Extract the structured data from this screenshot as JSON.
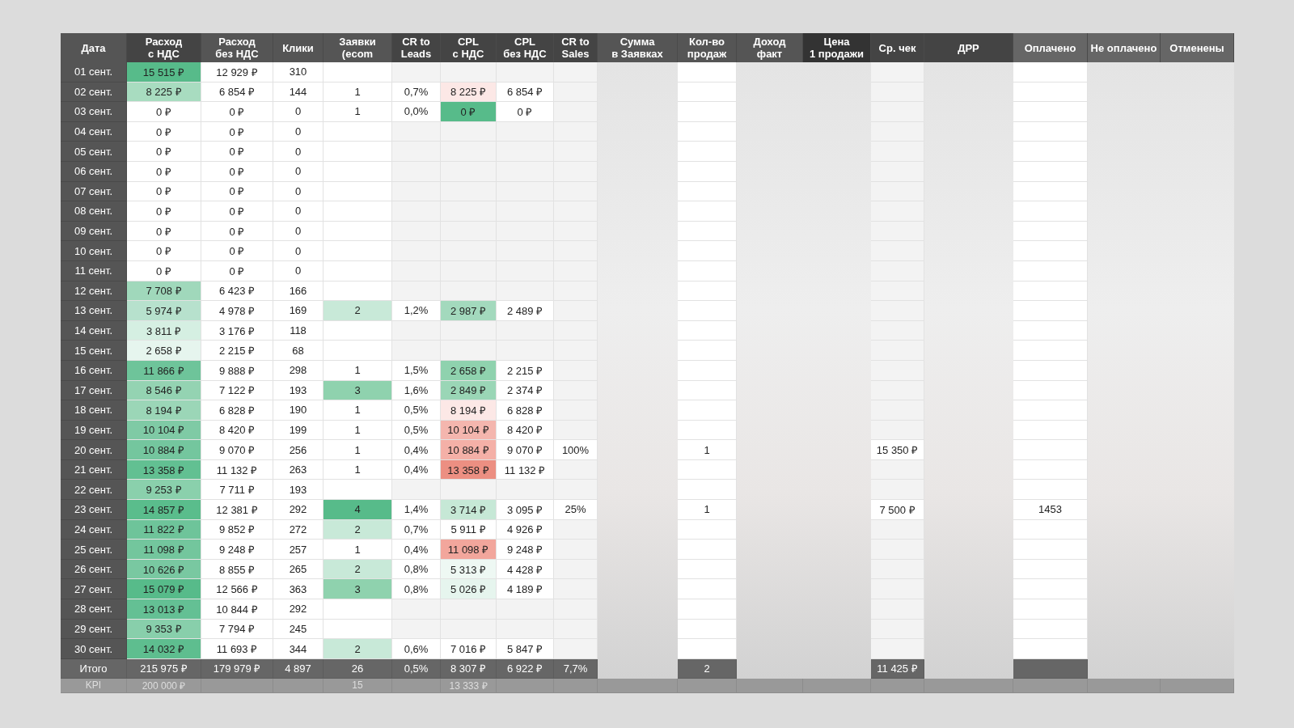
{
  "columns": [
    {
      "label": "Дата",
      "masked": false
    },
    {
      "label": "Расход\nс НДС",
      "masked": false
    },
    {
      "label": "Расход\nбез НДС",
      "masked": false
    },
    {
      "label": "Клики",
      "masked": false
    },
    {
      "label": "Заявки\n(ecom",
      "masked": false
    },
    {
      "label": "CR to\nLeads",
      "masked": false
    },
    {
      "label": "CPL\nс НДС",
      "masked": false
    },
    {
      "label": "CPL\nбез НДС",
      "masked": false
    },
    {
      "label": "CR to\nSales",
      "masked": false
    },
    {
      "label": "Сумма\nв Заявках",
      "masked": true
    },
    {
      "label": "Кол-во\nпродаж",
      "masked": false
    },
    {
      "label": "Доход\nфакт",
      "masked": true
    },
    {
      "label": "Цена\n1 продажи",
      "masked": true
    },
    {
      "label": "Ср. чек",
      "masked": false
    },
    {
      "label": "ДРР",
      "masked": true
    },
    {
      "label": "Оплачено",
      "masked": false
    },
    {
      "label": "Не оплачено",
      "masked": true
    },
    {
      "label": "Отменены",
      "masked": true
    }
  ],
  "rows": [
    {
      "date": "01 сент.",
      "spend_vat": {
        "text": "15 515 ₽",
        "color": "#57bb8a"
      },
      "spend_net": "12 929 ₽",
      "clicks": "310"
    },
    {
      "date": "02 сент.",
      "spend_vat": {
        "text": "8 225 ₽",
        "color": "#a8dcc0"
      },
      "spend_net": "6 854 ₽",
      "clicks": "144",
      "leads": "1",
      "cr_leads": "0,7%",
      "cpl_vat": {
        "text": "8 225 ₽",
        "color": "#fce8e6"
      },
      "cpl_net": "6 854 ₽"
    },
    {
      "date": "03 сент.",
      "spend_vat": "0 ₽",
      "spend_net": "0 ₽",
      "clicks": "0",
      "leads": "1",
      "cr_leads": "0,0%",
      "cpl_vat": {
        "text": "0 ₽",
        "color": "#57bb8a"
      },
      "cpl_net": "0 ₽"
    },
    {
      "date": "04 сент.",
      "spend_vat": "0 ₽",
      "spend_net": "0 ₽",
      "clicks": "0"
    },
    {
      "date": "05 сент.",
      "spend_vat": "0 ₽",
      "spend_net": "0 ₽",
      "clicks": "0"
    },
    {
      "date": "06 сент.",
      "spend_vat": "0 ₽",
      "spend_net": "0 ₽",
      "clicks": "0"
    },
    {
      "date": "07 сент.",
      "spend_vat": "0 ₽",
      "spend_net": "0 ₽",
      "clicks": "0"
    },
    {
      "date": "08 сент.",
      "spend_vat": "0 ₽",
      "spend_net": "0 ₽",
      "clicks": "0"
    },
    {
      "date": "09 сент.",
      "spend_vat": "0 ₽",
      "spend_net": "0 ₽",
      "clicks": "0"
    },
    {
      "date": "10 сент.",
      "spend_vat": "0 ₽",
      "spend_net": "0 ₽",
      "clicks": "0"
    },
    {
      "date": "11 сент.",
      "spend_vat": "0 ₽",
      "spend_net": "0 ₽",
      "clicks": "0"
    },
    {
      "date": "12 сент.",
      "spend_vat": {
        "text": "7 708 ₽",
        "color": "#a0d8bb"
      },
      "spend_net": "6 423 ₽",
      "clicks": "166"
    },
    {
      "date": "13 сент.",
      "spend_vat": {
        "text": "5 974 ₽",
        "color": "#b7e1cd"
      },
      "spend_net": "4 978 ₽",
      "clicks": "169",
      "leads": {
        "text": "2",
        "color": "#c8e9d8"
      },
      "cr_leads": "1,2%",
      "cpl_vat": {
        "text": "2 987 ₽",
        "color": "#a3d9bd"
      },
      "cpl_net": "2 489 ₽"
    },
    {
      "date": "14 сент.",
      "spend_vat": {
        "text": "3 811 ₽",
        "color": "#d5efe2"
      },
      "spend_net": "3 176 ₽",
      "clicks": "118"
    },
    {
      "date": "15 сент.",
      "spend_vat": {
        "text": "2 658 ₽",
        "color": "#e6f5ee"
      },
      "spend_net": "2 215 ₽",
      "clicks": "68"
    },
    {
      "date": "16 сент.",
      "spend_vat": {
        "text": "11 866 ₽",
        "color": "#6ec49a"
      },
      "spend_net": "9 888 ₽",
      "clicks": "298",
      "leads": "1",
      "cr_leads": "1,5%",
      "cpl_vat": {
        "text": "2 658 ₽",
        "color": "#8fd2ae"
      },
      "cpl_net": "2 215 ₽"
    },
    {
      "date": "17 сент.",
      "spend_vat": {
        "text": "8 546 ₽",
        "color": "#94d3b2"
      },
      "spend_net": "7 122 ₽",
      "clicks": "193",
      "leads": {
        "text": "3",
        "color": "#8fd2ae"
      },
      "cr_leads": "1,6%",
      "cpl_vat": {
        "text": "2 849 ₽",
        "color": "#9ad6b6"
      },
      "cpl_net": "2 374 ₽"
    },
    {
      "date": "18 сент.",
      "spend_vat": {
        "text": "8 194 ₽",
        "color": "#9bd6b7"
      },
      "spend_net": "6 828 ₽",
      "clicks": "190",
      "leads": "1",
      "cr_leads": "0,5%",
      "cpl_vat": {
        "text": "8 194 ₽",
        "color": "#fce8e6"
      },
      "cpl_net": "6 828 ₽"
    },
    {
      "date": "19 сент.",
      "spend_vat": {
        "text": "10 104 ₽",
        "color": "#7fcaa5"
      },
      "spend_net": "8 420 ₽",
      "clicks": "199",
      "leads": "1",
      "cr_leads": "0,5%",
      "cpl_vat": {
        "text": "10 104 ₽",
        "color": "#f4b6ae"
      },
      "cpl_net": "8 420 ₽"
    },
    {
      "date": "20 сент.",
      "spend_vat": {
        "text": "10 884 ₽",
        "color": "#74c69e"
      },
      "spend_net": "9 070 ₽",
      "clicks": "256",
      "leads": "1",
      "cr_leads": "0,4%",
      "cpl_vat": {
        "text": "10 884 ₽",
        "color": "#f4b0a7"
      },
      "cpl_net": "9 070 ₽",
      "cr_sales": "100%",
      "sales_count": "1",
      "avg_check": "15 350 ₽"
    },
    {
      "date": "21 сент.",
      "spend_vat": {
        "text": "13 358 ₽",
        "color": "#62c092"
      },
      "spend_net": "11 132 ₽",
      "clicks": "263",
      "leads": "1",
      "cr_leads": "0,4%",
      "cpl_vat": {
        "text": "13 358 ₽",
        "color": "#ec8f82"
      },
      "cpl_net": "11 132 ₽"
    },
    {
      "date": "22 сент.",
      "spend_vat": {
        "text": "9 253 ₽",
        "color": "#8ad0ac"
      },
      "spend_net": "7 711 ₽",
      "clicks": "193"
    },
    {
      "date": "23 сент.",
      "spend_vat": {
        "text": "14 857 ₽",
        "color": "#5abd8c"
      },
      "spend_net": "12 381 ₽",
      "clicks": "292",
      "leads": {
        "text": "4",
        "color": "#57bb8a"
      },
      "cr_leads": "1,4%",
      "cpl_vat": {
        "text": "3 714 ₽",
        "color": "#c6e8d6"
      },
      "cpl_net": "3 095 ₽",
      "cr_sales": "25%",
      "sales_count": "1",
      "avg_check": "7 500 ₽",
      "paid": "1453"
    },
    {
      "date": "24 сент.",
      "spend_vat": {
        "text": "11 822 ₽",
        "color": "#6ec49a"
      },
      "spend_net": "9 852 ₽",
      "clicks": "272",
      "leads": {
        "text": "2",
        "color": "#c8e9d8"
      },
      "cr_leads": "0,7%",
      "cpl_vat": "5 911 ₽",
      "cpl_net": "4 926 ₽"
    },
    {
      "date": "25 сент.",
      "spend_vat": {
        "text": "11 098 ₽",
        "color": "#73c69d"
      },
      "spend_net": "9 248 ₽",
      "clicks": "257",
      "leads": "1",
      "cr_leads": "0,4%",
      "cpl_vat": {
        "text": "11 098 ₽",
        "color": "#f2a69c"
      },
      "cpl_net": "9 248 ₽"
    },
    {
      "date": "26 сент.",
      "spend_vat": {
        "text": "10 626 ₽",
        "color": "#79c8a1"
      },
      "spend_net": "8 855 ₽",
      "clicks": "265",
      "leads": {
        "text": "2",
        "color": "#c8e9d8"
      },
      "cr_leads": "0,8%",
      "cpl_vat": {
        "text": "5 313 ₽",
        "color": "#eef8f3"
      },
      "cpl_net": "4 428 ₽"
    },
    {
      "date": "27 сент.",
      "spend_vat": {
        "text": "15 079 ₽",
        "color": "#57bb8a"
      },
      "spend_net": "12 566 ₽",
      "clicks": "363",
      "leads": {
        "text": "3",
        "color": "#8fd2ae"
      },
      "cr_leads": "0,8%",
      "cpl_vat": {
        "text": "5 026 ₽",
        "color": "#e6f5ee"
      },
      "cpl_net": "4 189 ₽"
    },
    {
      "date": "28 сент.",
      "spend_vat": {
        "text": "13 013 ₽",
        "color": "#64c094"
      },
      "spend_net": "10 844 ₽",
      "clicks": "292"
    },
    {
      "date": "29 сент.",
      "spend_vat": {
        "text": "9 353 ₽",
        "color": "#88cfab"
      },
      "spend_net": "7 794 ₽",
      "clicks": "245"
    },
    {
      "date": "30 сент.",
      "spend_vat": {
        "text": "14 032 ₽",
        "color": "#5ebe8f"
      },
      "spend_net": "11 693 ₽",
      "clicks": "344",
      "leads": {
        "text": "2",
        "color": "#c8e9d8"
      },
      "cr_leads": "0,6%",
      "cpl_vat": "7 016 ₽",
      "cpl_net": "5 847 ₽"
    }
  ],
  "total": {
    "date": "Итого",
    "spend_vat": "215 975 ₽",
    "spend_net": "179 979 ₽",
    "clicks": "4 897",
    "leads": "26",
    "cr_leads": "0,5%",
    "cpl_vat": "8 307 ₽",
    "cpl_net": "6 922 ₽",
    "cr_sales": "7,7%",
    "sales_count": "2",
    "avg_check": "11 425 ₽"
  },
  "kpi": {
    "date": "KPI",
    "spend_vat": "200 000 ₽",
    "leads": "15",
    "cpl_vat": "13 333 ₽"
  }
}
